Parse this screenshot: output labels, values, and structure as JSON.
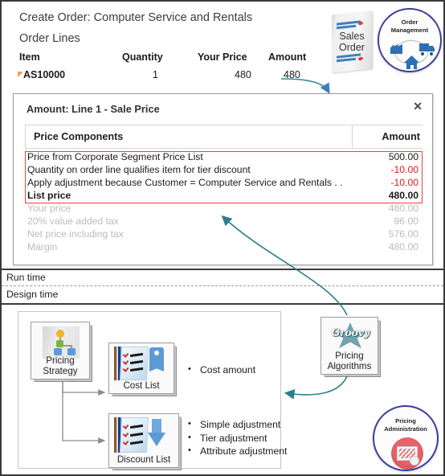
{
  "runtime": {
    "page_title": "Create Order: Computer Service and Rentals",
    "section_title": "Order Lines",
    "order_lines": {
      "columns": [
        "Item",
        "Quantity",
        "Your Price",
        "Amount"
      ],
      "rows": [
        {
          "item": "AS10000",
          "quantity": "1",
          "your_price": "480",
          "amount": "480"
        }
      ]
    },
    "sales_order_icon": {
      "line1": "Sales",
      "line2": "Order"
    },
    "order_management_badge": {
      "line1": "Order",
      "line2": "Management"
    }
  },
  "dialog": {
    "title": "Amount: Line 1 - Sale Price",
    "close_label": "✕",
    "table": {
      "header_components": "Price Components",
      "header_amount": "Amount",
      "rows": [
        {
          "label": "Price from Corporate  Segment Price List",
          "amount": "500.00",
          "style": "normal"
        },
        {
          "label": "Quantity on order  line qualifies  item for  tier discount",
          "amount": "-10.00",
          "style": "negative"
        },
        {
          "label": "Apply adjustment because Customer = Computer  Service  and Rentals . .",
          "amount": "-10.00",
          "style": "negative"
        },
        {
          "label": "List price",
          "amount": "480.00",
          "style": "bold"
        },
        {
          "label": "Your price",
          "amount": "480.00",
          "style": "muted"
        },
        {
          "label": "20% value  added tax",
          "amount": "96.00",
          "style": "muted"
        },
        {
          "label": "Net price including tax",
          "amount": "576.00",
          "style": "muted"
        },
        {
          "label": "Margin",
          "amount": "480.00",
          "style": "muted"
        }
      ]
    }
  },
  "dividers": {
    "runtime_label": "Run time",
    "designtime_label": "Design time"
  },
  "designtime": {
    "pricing_strategy": {
      "line1": "Pricing",
      "line2": "Strategy"
    },
    "cost_list": {
      "label": "Cost List"
    },
    "discount_list": {
      "label": "Discount List"
    },
    "pricing_algorithms": {
      "logo_word": "Groovy",
      "line1": "Pricing",
      "line2": "Algorithms"
    },
    "pricing_admin_badge": {
      "line1": "Pricing",
      "line2": "Administration"
    },
    "cost_bullets": [
      "Cost amount"
    ],
    "discount_bullets": [
      "Simple adjustment",
      "Tier  adjustment",
      "Attribute adjustment"
    ]
  },
  "colors": {
    "accent_teal": "#2d7f8e",
    "negative_red": "#e01b1b",
    "highlight_red": "#e8443c",
    "badge_blue": "#3b3f9e",
    "link_blue": "#6b9bd2",
    "muted_grey": "#bcbcbc"
  }
}
